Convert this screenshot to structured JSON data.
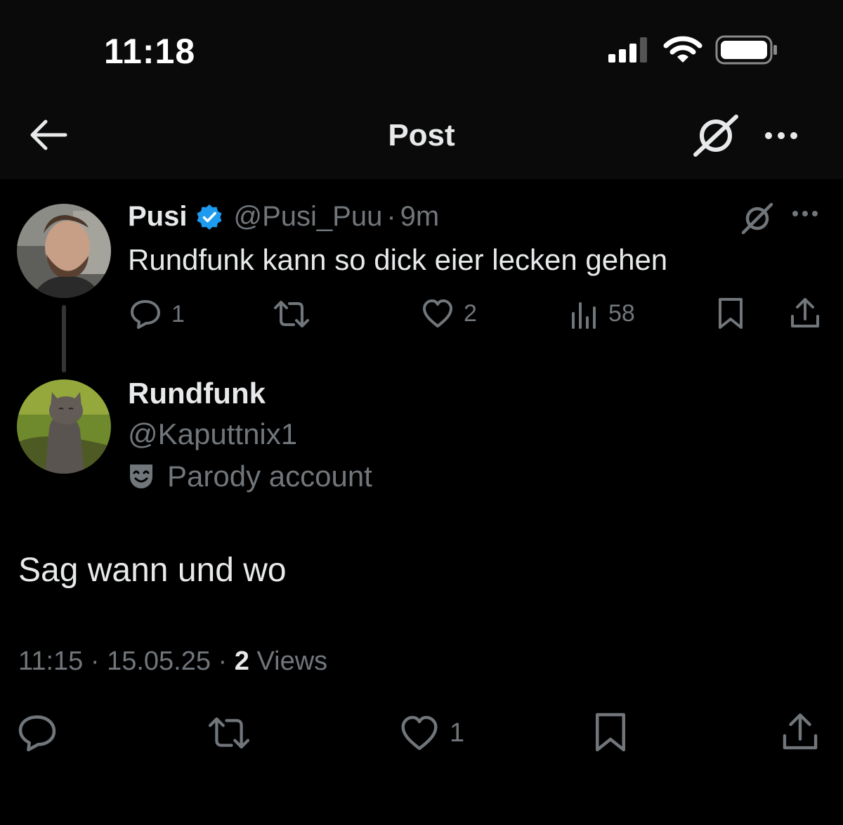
{
  "status_bar": {
    "time": "11:18"
  },
  "nav": {
    "title": "Post"
  },
  "parent_tweet": {
    "name": "Pusi",
    "handle": "@Pusi_Puu",
    "separator": "·",
    "time": "9m",
    "text": "Rundfunk kann so dick eier lecken gehen",
    "replies": "1",
    "likes": "2",
    "views": "58"
  },
  "main_tweet": {
    "name": "Rundfunk",
    "handle": "@Kaputtnix1",
    "label": "Parody account",
    "text": "Sag wann und wo",
    "time": "11:15",
    "date": "15.05.25",
    "separator": "·",
    "views_count": "2",
    "views_label": "Views",
    "likes": "1"
  },
  "colors": {
    "background": "#000000",
    "primary_text": "#e7e9ea",
    "secondary_text": "#71767b",
    "verified_blue": "#1d9bf0"
  }
}
